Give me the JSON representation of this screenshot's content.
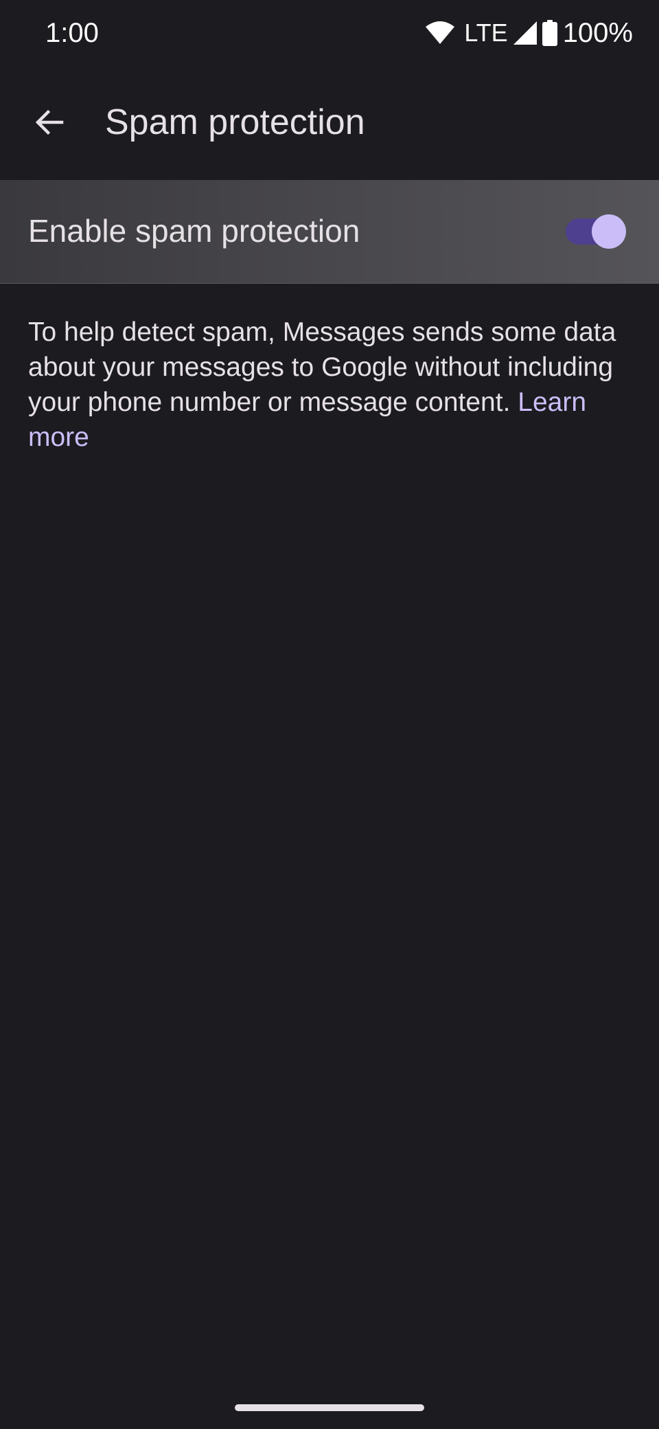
{
  "status_bar": {
    "time": "1:00",
    "network": "LTE",
    "battery": "100%",
    "icons": [
      "wifi-icon",
      "cellular-signal-icon",
      "battery-icon"
    ]
  },
  "app_bar": {
    "title": "Spam protection",
    "back_icon": "arrow-back-icon"
  },
  "settings": {
    "spam_toggle": {
      "label": "Enable spam protection",
      "enabled": true
    }
  },
  "description": {
    "text": "To help detect spam, Messages sends some data about your messages to Google without including your phone number or message content. ",
    "link_text": "Learn more"
  },
  "colors": {
    "background": "#1c1b20",
    "accent": "#cbbef8",
    "switch_track": "#4f3f8f"
  }
}
